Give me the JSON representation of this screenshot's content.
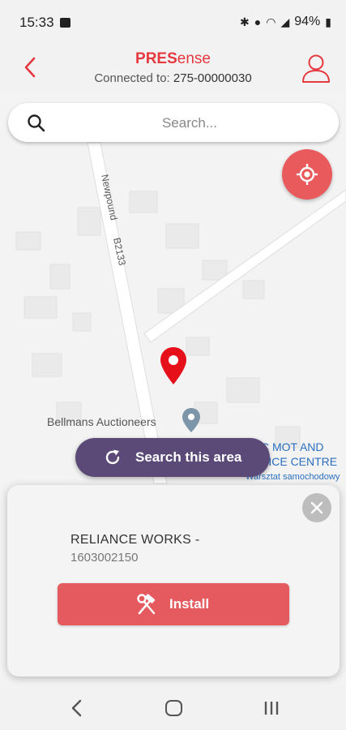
{
  "status_bar": {
    "time": "15:33",
    "battery": "94%",
    "icons": [
      "image-icon",
      "bluetooth-icon",
      "location-icon",
      "wifi-icon",
      "signal-icon",
      "battery-icon"
    ]
  },
  "header": {
    "brand_bold": "PRES",
    "brand_light": "ense",
    "connected_label": "Connected to:",
    "device_id": "275-00000030"
  },
  "search": {
    "placeholder": "Search..."
  },
  "map": {
    "road_label": "Newpound",
    "road_code": "B2133",
    "poi_label": "Bellmans Auctioneers",
    "mot_label_line1": "C MOT AND",
    "mot_label_line2": "VICE CENTRE",
    "mot_sub": "Warsztat samochodowy"
  },
  "search_area_button": {
    "label": "Search this area"
  },
  "card": {
    "site_name": "RELIANCE WORKS -",
    "site_id": "1603002150",
    "install_label": "Install"
  },
  "colors": {
    "brand_red": "#e5383f",
    "install_red": "#e55a5e",
    "search_area_purple": "#5b4a78",
    "link_blue": "#2b6fbf"
  }
}
